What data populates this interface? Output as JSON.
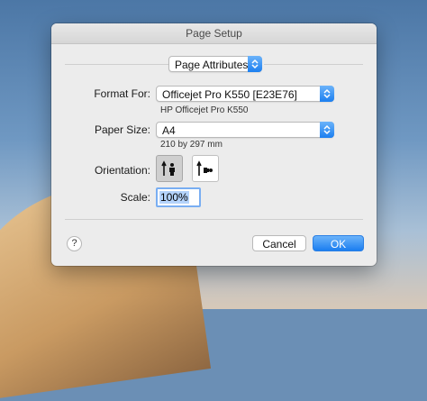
{
  "dialog": {
    "title": "Page Setup",
    "settings_popup": "Page Attributes",
    "format_for": {
      "label": "Format For:",
      "value": "Officejet Pro K550 [E23E76]",
      "description": "HP Officejet Pro K550"
    },
    "paper_size": {
      "label": "Paper Size:",
      "value": "A4",
      "description": "210 by 297 mm"
    },
    "orientation": {
      "label": "Orientation:",
      "selected": "portrait"
    },
    "scale": {
      "label": "Scale:",
      "value": "100%"
    },
    "help_label": "?",
    "cancel_label": "Cancel",
    "ok_label": "OK"
  },
  "colors": {
    "accent": "#1c7ff0",
    "window_bg": "#ececec"
  },
  "icons": [
    "chevron-updown-icon",
    "portrait-orientation-icon",
    "landscape-orientation-icon",
    "help-icon"
  ]
}
